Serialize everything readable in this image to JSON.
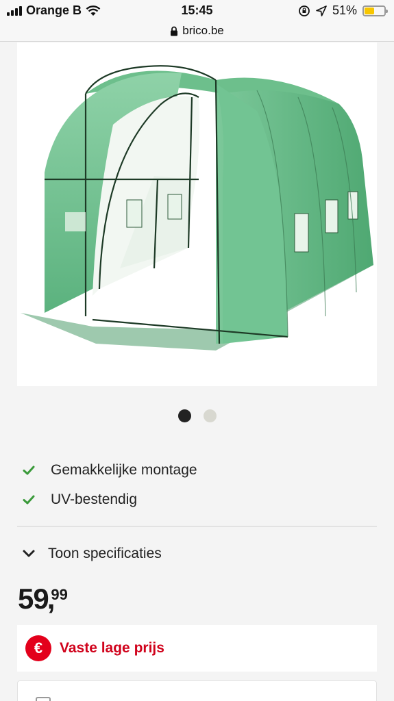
{
  "status_bar": {
    "carrier": "Orange B",
    "time": "15:45",
    "battery": "51%",
    "battery_level": 0.51,
    "icons": [
      "signal-icon",
      "wifi-icon",
      "orientation-lock-icon",
      "location-icon",
      "battery-icon"
    ]
  },
  "browser": {
    "url": "brico.be",
    "icon": "lock-icon"
  },
  "product": {
    "image_icon": "greenhouse-image",
    "carousel": {
      "total": 2,
      "active": 1
    },
    "features": [
      {
        "label": "Gemakkelijke montage",
        "icon": "check-icon"
      },
      {
        "label": "UV-bestendig",
        "icon": "check-icon"
      }
    ],
    "spec_toggle_label": "Toon specificaties",
    "spec_toggle_icon": "chevron-down-icon",
    "price": {
      "integer": "59",
      "separator": ",",
      "decimals": "99"
    },
    "price_banner": {
      "badge": "€",
      "label": "Vaste lage prijs"
    }
  },
  "colors": {
    "accent_red": "#e3001b",
    "check_green": "#3a9a3a",
    "greenhouse_green": "#5fb87d"
  }
}
